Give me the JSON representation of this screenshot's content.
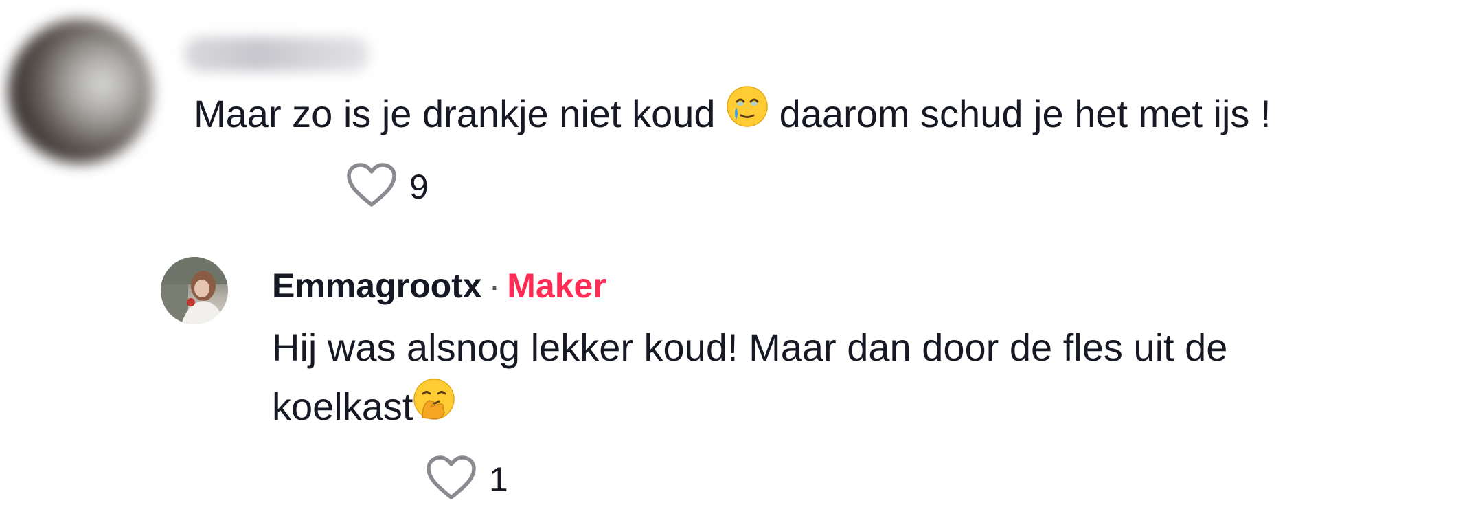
{
  "comment": {
    "text_before_emoji": "Maar zo is je drankje niet koud ",
    "emoji": "face-holding-back-tears",
    "text_after_emoji": " daarom schud je het met ijs !",
    "like_count": "9"
  },
  "reply": {
    "username": "Emmagrootx",
    "separator": "·",
    "badge": "Maker",
    "line1": "Hij was alsnog lekker koud! Maar dan door de fles uit de",
    "line2": "koelkast",
    "emoji": "face-with-hand-over-mouth",
    "like_count": "1"
  },
  "colors": {
    "text": "#161823",
    "maker_badge": "#fe2c55",
    "icon_gray": "#8a8b91"
  }
}
